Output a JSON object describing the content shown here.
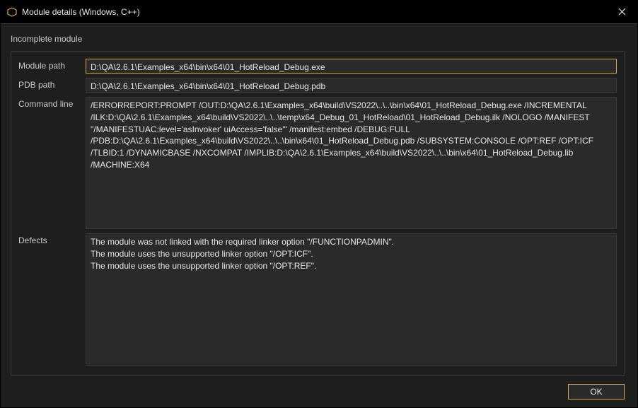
{
  "titlebar": {
    "title": "Module details (Windows, C++)"
  },
  "section_title": "Incomplete module",
  "labels": {
    "module_path": "Module path",
    "pdb_path": "PDB path",
    "command_line": "Command line",
    "defects": "Defects"
  },
  "fields": {
    "module_path": "D:\\QA\\2.6.1\\Examples_x64\\bin\\x64\\01_HotReload_Debug.exe",
    "pdb_path": "D:\\QA\\2.6.1\\Examples_x64\\bin\\x64\\01_HotReload_Debug.pdb",
    "command_line": "/ERRORREPORT:PROMPT /OUT:D:\\QA\\2.6.1\\Examples_x64\\build\\VS2022\\..\\..\\bin\\x64\\01_HotReload_Debug.exe /INCREMENTAL /ILK:D:\\QA\\2.6.1\\Examples_x64\\build\\VS2022\\..\\..\\temp\\x64_Debug_01_HotReload\\01_HotReload_Debug.ilk /NOLOGO /MANIFEST \"/MANIFESTUAC:level='asInvoker' uiAccess='false'\" /manifest:embed /DEBUG:FULL /PDB:D:\\QA\\2.6.1\\Examples_x64\\build\\VS2022\\..\\..\\bin\\x64\\01_HotReload_Debug.pdb /SUBSYSTEM:CONSOLE /OPT:REF /OPT:ICF /TLBID:1 /DYNAMICBASE /NXCOMPAT /IMPLIB:D:\\QA\\2.6.1\\Examples_x64\\build\\VS2022\\..\\..\\bin\\x64\\01_HotReload_Debug.lib /MACHINE:X64",
    "defects": "The module was not linked with the required linker option \"/FUNCTIONPADMIN\".\nThe module uses the unsupported linker option \"/OPT:ICF\".\nThe module uses the unsupported linker option \"/OPT:REF\"."
  },
  "buttons": {
    "ok": "OK"
  }
}
